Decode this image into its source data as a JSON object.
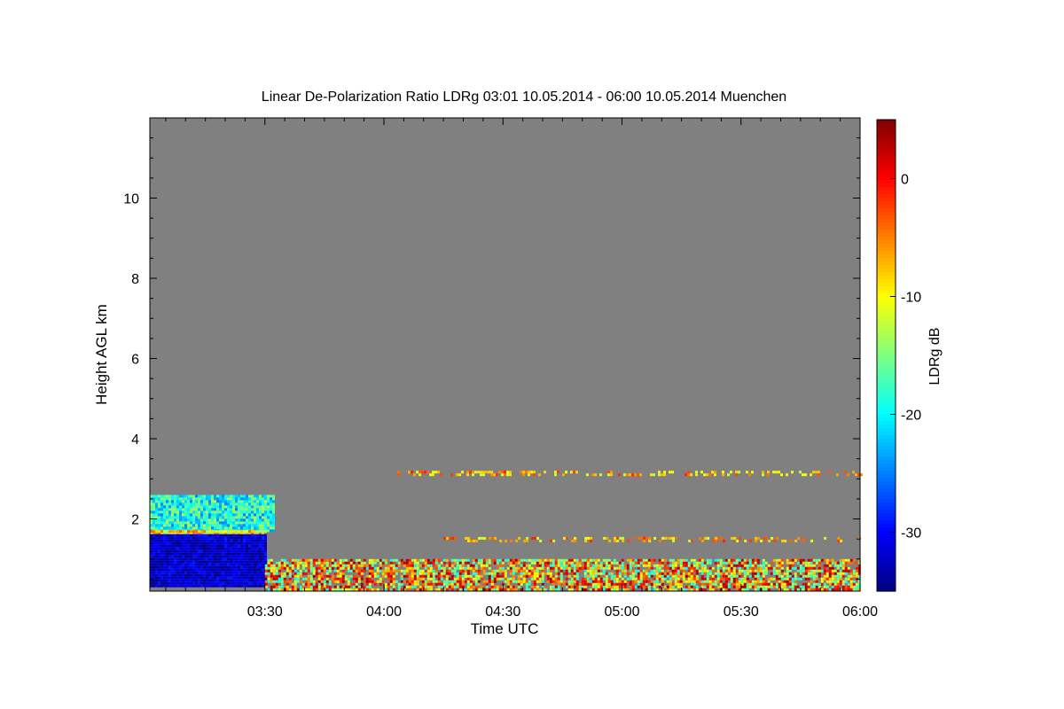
{
  "chart_data": {
    "type": "heatmap",
    "title": "Linear De-Polarization Ratio LDRg   03:01 10.05.2014 - 06:00 10.05.2014 Muenchen",
    "xlabel": "Time UTC",
    "ylabel": "Height AGL km",
    "colorbar_label": "LDRg dB",
    "x_range_minutes_utc": [
      181,
      360
    ],
    "y_range_km": [
      0.2,
      12.0
    ],
    "x_ticks": [
      {
        "label": "03:30",
        "minutes": 210
      },
      {
        "label": "04:00",
        "minutes": 240
      },
      {
        "label": "04:30",
        "minutes": 270
      },
      {
        "label": "05:00",
        "minutes": 300
      },
      {
        "label": "05:30",
        "minutes": 330
      },
      {
        "label": "06:00",
        "minutes": 360
      }
    ],
    "y_ticks": [
      {
        "label": "2",
        "value": 2
      },
      {
        "label": "4",
        "value": 4
      },
      {
        "label": "6",
        "value": 6
      },
      {
        "label": "8",
        "value": 8
      },
      {
        "label": "10",
        "value": 10
      }
    ],
    "colorbar": {
      "range_db": [
        -35,
        5
      ],
      "colormap": "jet",
      "ticks": [
        {
          "label": "0",
          "value": 0
        },
        {
          "label": "-10",
          "value": -10
        },
        {
          "label": "-20",
          "value": -20
        },
        {
          "label": "-30",
          "value": -30
        }
      ]
    },
    "no_data_color": "#808080",
    "features": [
      {
        "name": "cloud layer",
        "t_start": 181,
        "t_end": 212,
        "h_bottom": 1.7,
        "h_top": 2.6,
        "ldr_db": -19
      },
      {
        "name": "cloud base streak",
        "t_start": 181,
        "t_end": 210,
        "h_bottom": 1.62,
        "h_top": 1.72,
        "ldr_db": -9
      },
      {
        "name": "precipitation",
        "t_start": 181,
        "t_end": 210,
        "h_bottom": 0.35,
        "h_top": 1.62,
        "ldr_db": -32
      },
      {
        "name": "boundary layer",
        "t_start": 210,
        "t_end": 360,
        "h_bottom": 0.25,
        "h_top": 1.0,
        "ldr_db": -8
      },
      {
        "name": "aerosol layer",
        "t_start": 242,
        "t_end": 360,
        "h_bottom": 3.1,
        "h_top": 3.2,
        "ldr_db": -7
      },
      {
        "name": "aerosol layer",
        "t_start": 255,
        "t_end": 360,
        "h_bottom": 1.45,
        "h_top": 1.55,
        "ldr_db": -7
      }
    ]
  }
}
